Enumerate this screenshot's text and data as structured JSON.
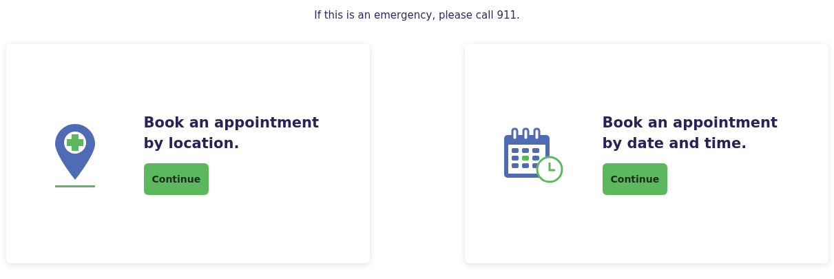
{
  "notice": "If this is an emergency, please call 911.",
  "cards": [
    {
      "kind": "location",
      "title": "Book an appointment by location.",
      "button": "Continue"
    },
    {
      "kind": "calendar",
      "title": "Book an appointment by date and time.",
      "button": "Continue"
    }
  ]
}
